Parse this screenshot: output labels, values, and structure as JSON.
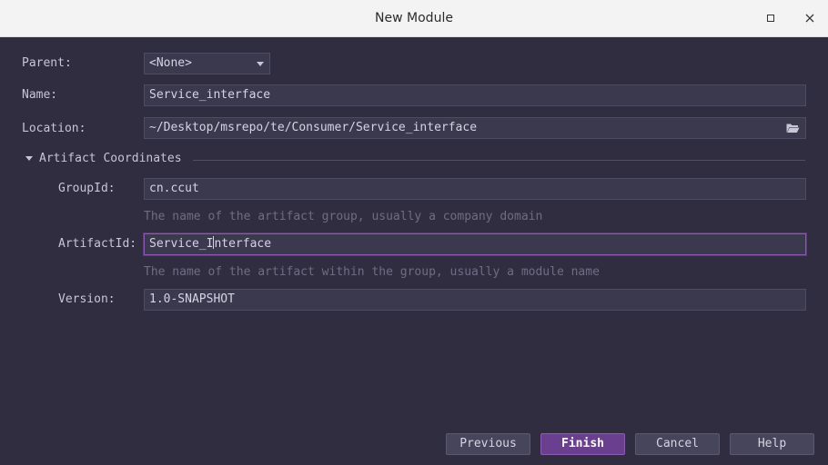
{
  "window": {
    "title": "New Module"
  },
  "form": {
    "parent_label": "Parent:",
    "parent_value": "<None>",
    "name_label": "Name:",
    "name_value": "Service_interface",
    "location_label": "Location:",
    "location_value": "~/Desktop/msrepo/te/Consumer/Service_interface"
  },
  "artifact": {
    "section_title": "Artifact Coordinates",
    "groupid_label": "GroupId:",
    "groupid_value": "cn.ccut",
    "groupid_hint": "The name of the artifact group, usually a company domain",
    "artifactid_label": "ArtifactId:",
    "artifactid_value_before_caret": "Service_I",
    "artifactid_value_after_caret": "nterface",
    "artifactid_hint": "The name of the artifact within the group, usually a module name",
    "version_label": "Version:",
    "version_value": "1.0-SNAPSHOT"
  },
  "buttons": {
    "previous": "Previous",
    "finish": "Finish",
    "cancel": "Cancel",
    "help": "Help"
  },
  "icons": {
    "maximize": "maximize-icon",
    "close": "close-icon",
    "dropdown": "chevron-down-icon",
    "folder": "folder-open-icon",
    "collapse": "triangle-down-icon"
  },
  "colors": {
    "background": "#2f2d3f",
    "field": "#3b394e",
    "accent": "#6b3f8f",
    "focus_border": "#8e56b7",
    "hint": "#6f6d84"
  }
}
